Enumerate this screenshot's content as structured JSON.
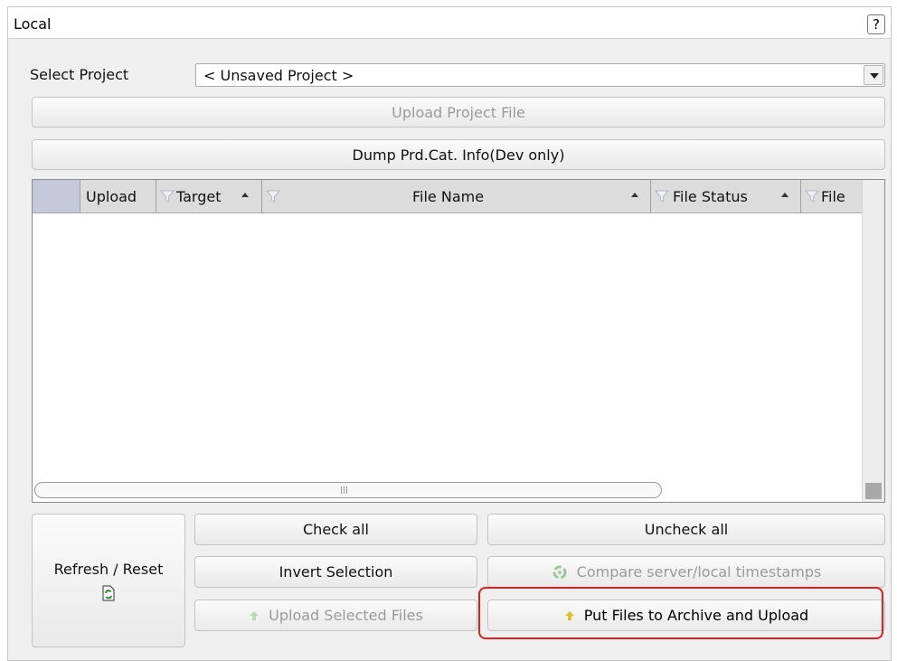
{
  "window": {
    "title": "Local",
    "help_label": "?"
  },
  "project": {
    "label": "Select Project",
    "selected": "< Unsaved Project >"
  },
  "buttons": {
    "upload_project_file": "Upload Project File",
    "dump_info": "Dump Prd.Cat. Info(Dev only)",
    "refresh_reset": "Refresh / Reset",
    "check_all": "Check all",
    "uncheck_all": "Uncheck all",
    "invert_selection": "Invert Selection",
    "compare_timestamps": "Compare server/local timestamps",
    "upload_selected": "Upload Selected Files",
    "put_files_archive": "Put Files to Archive and Upload"
  },
  "grid": {
    "columns": [
      {
        "label": "Upload"
      },
      {
        "label": "Target"
      },
      {
        "label": "File Name"
      },
      {
        "label": "File Status"
      },
      {
        "label": "File"
      }
    ],
    "rows": []
  },
  "colors": {
    "panel_bg": "#efefef",
    "highlight": "#e02020",
    "refresh_icon": "#2e8b2e",
    "upload_arrow": "#d7c32a"
  },
  "icons": [
    "help-icon",
    "dropdown-arrow-icon",
    "filter-icon",
    "sort-asc-icon",
    "refresh-icon",
    "compare-icon",
    "upload-arrow-icon"
  ]
}
